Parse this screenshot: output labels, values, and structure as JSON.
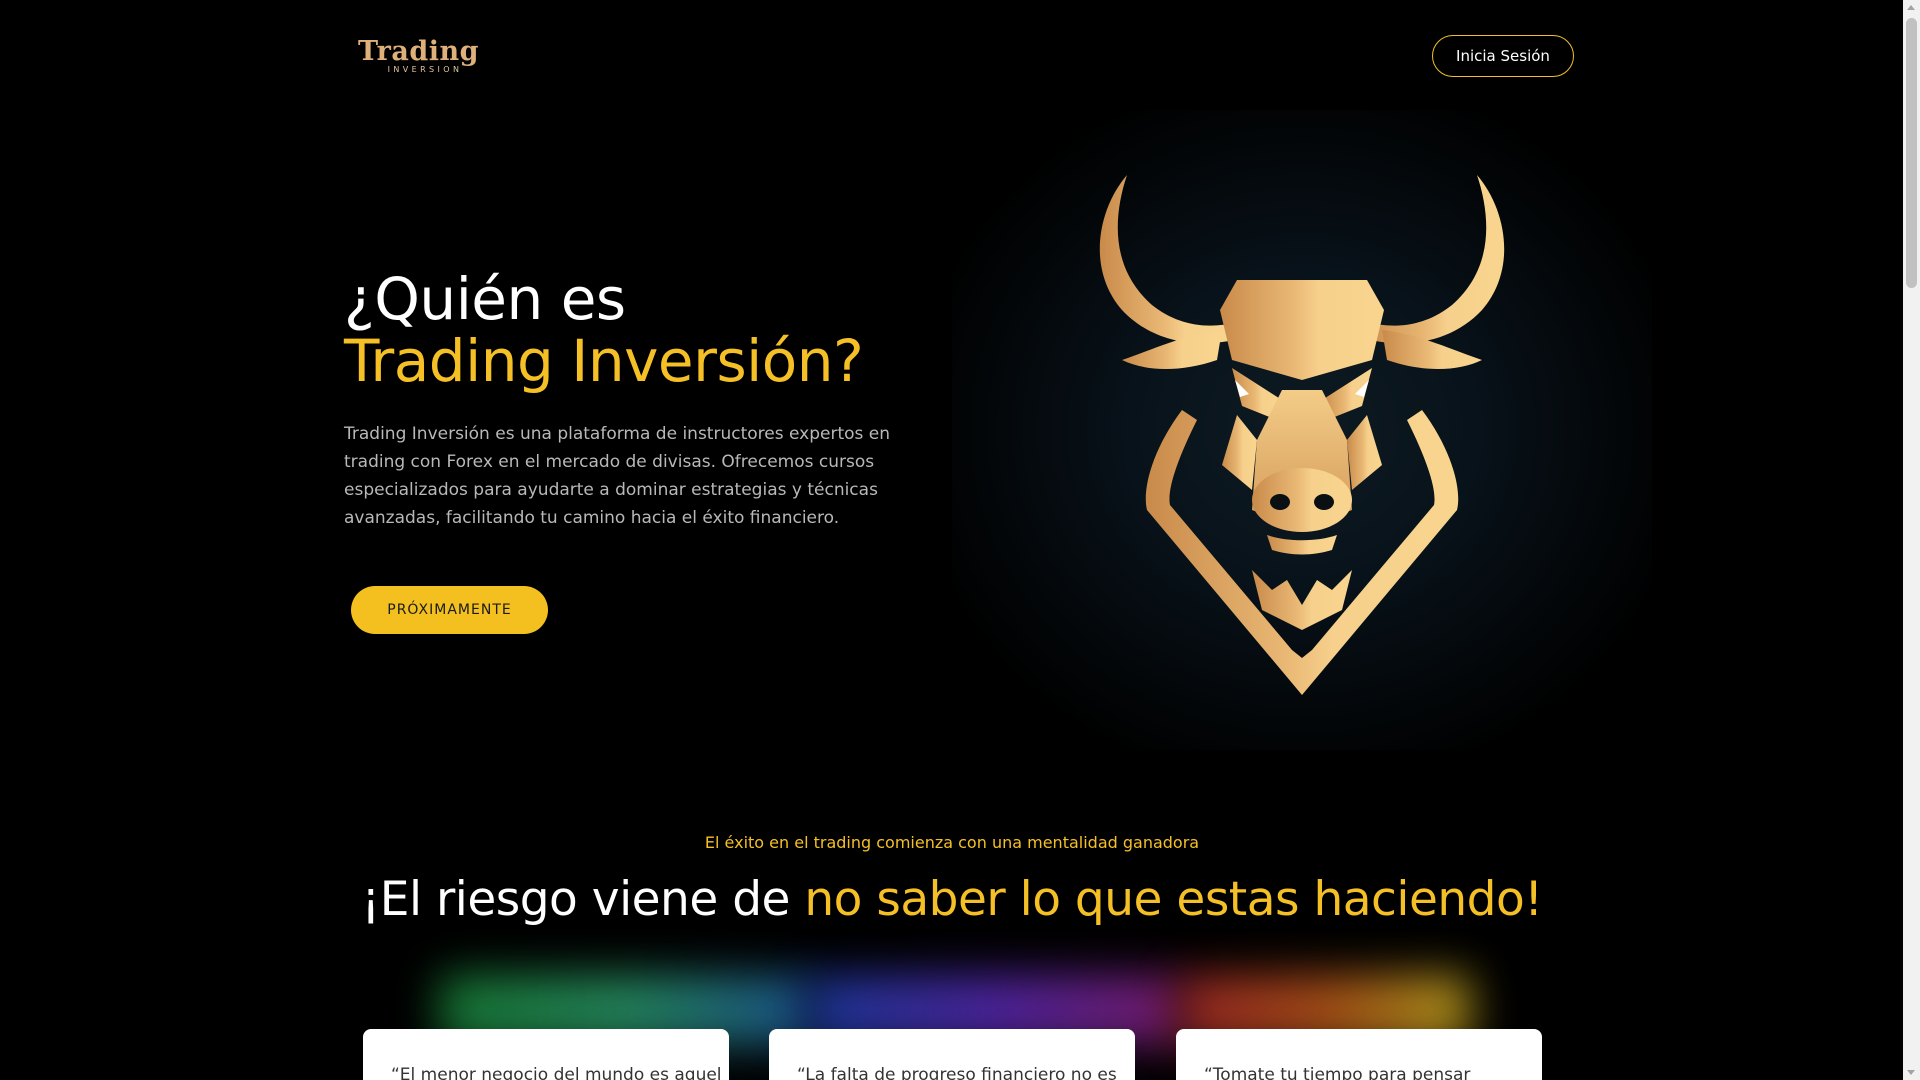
{
  "header": {
    "logo_main": "Trading",
    "logo_sub": "INVERSION",
    "login_label": "Inicia Sesión"
  },
  "hero": {
    "title_line1": "¿Quién es",
    "title_line2": "Trading Inversión?",
    "description": "Trading Inversión es una plataforma de instructores expertos en trading con Forex en el mercado de divisas. Ofrecemos cursos especializados para ayudarte a dominar estrategias y técnicas avanzadas, facilitando tu camino hacia el éxito financiero.",
    "cta_label": "PRÓXIMAMENTE",
    "image_icon": "golden-bull-icon"
  },
  "section2": {
    "tagline": "El éxito en el trading comienza con una mentalidad ganadora",
    "title_white": "¡El riesgo viene de ",
    "title_yellow": "no saber lo que estas haciendo!"
  },
  "cards": [
    {
      "text": "“El menor negocio del mundo es aquel"
    },
    {
      "text": "“La falta de progreso financiero no es"
    },
    {
      "text": "“Tomate tu tiempo para pensar"
    }
  ],
  "colors": {
    "accent": "#f5c026",
    "background": "#000000",
    "gold": "#d9a15c"
  }
}
